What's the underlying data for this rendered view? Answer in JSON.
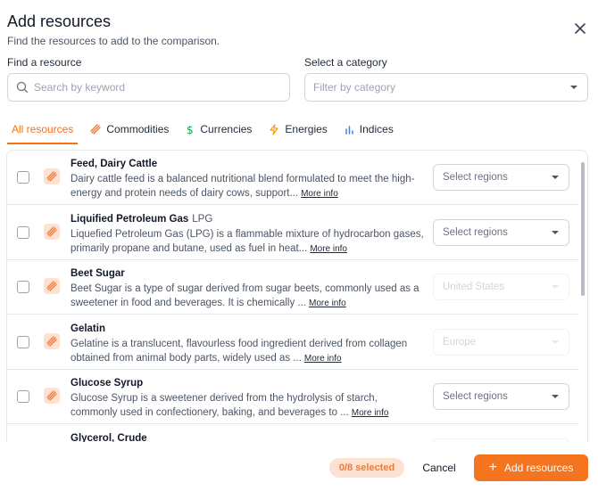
{
  "dialog": {
    "title": "Add resources",
    "subtitle": "Find the resources to add to the comparison."
  },
  "search": {
    "label": "Find a resource",
    "placeholder": "Search by keyword"
  },
  "category": {
    "label": "Select a category",
    "placeholder": "Filter by category"
  },
  "tabs": [
    {
      "label": "All resources",
      "icon": "none",
      "active": true
    },
    {
      "label": "Commodities",
      "icon": "commodity-icon"
    },
    {
      "label": "Currencies",
      "icon": "dollar-icon"
    },
    {
      "label": "Energies",
      "icon": "lightning-icon"
    },
    {
      "label": "Indices",
      "icon": "bar-chart-icon"
    }
  ],
  "resources": [
    {
      "title": "Feed, Dairy Cattle",
      "abbr": "",
      "desc_line1": "Dairy cattle feed is a balanced nutritional blend formulated to meet the high-",
      "desc_line2": "energy and protein needs of dairy cows, support...",
      "more": "More info",
      "region": "Select regions",
      "region_disabled": false
    },
    {
      "title": "Liquified Petroleum Gas",
      "abbr": "LPG",
      "desc_line1": "Liquefied Petroleum Gas (LPG) is a flammable mixture of hydrocarbon gases,",
      "desc_line2": "primarily propane and butane, used as fuel in heat...",
      "more": "More info",
      "region": "Select regions",
      "region_disabled": false
    },
    {
      "title": "Beet Sugar",
      "abbr": "",
      "desc_line1": "Beet Sugar is a type of sugar derived from sugar beets, commonly used as a",
      "desc_line2": "sweetener in food and beverages. It is chemically ...",
      "more": "More info",
      "region": "United States",
      "region_disabled": true
    },
    {
      "title": "Gelatin",
      "abbr": "",
      "desc_line1": "Gelatine is a translucent, flavourless food ingredient derived from collagen",
      "desc_line2": "obtained from animal body parts, widely used as ...",
      "more": "More info",
      "region": "Europe",
      "region_disabled": true
    },
    {
      "title": "Glucose Syrup",
      "abbr": "",
      "desc_line1": "Glucose Syrup is a sweetener derived from the hydrolysis of starch,",
      "desc_line2": "commonly used in confectionery, baking, and beverages to ...",
      "more": "More info",
      "region": "Select regions",
      "region_disabled": false
    },
    {
      "title": "Glycerol, Crude",
      "abbr": "",
      "desc_line1": "",
      "desc_line2": "",
      "more": "",
      "region": "",
      "region_disabled": true
    }
  ],
  "footer": {
    "selected": "0/8 selected",
    "cancel": "Cancel",
    "add": "Add resources"
  },
  "colors": {
    "accent": "#f47420",
    "accent_soft": "#fde2d2"
  }
}
